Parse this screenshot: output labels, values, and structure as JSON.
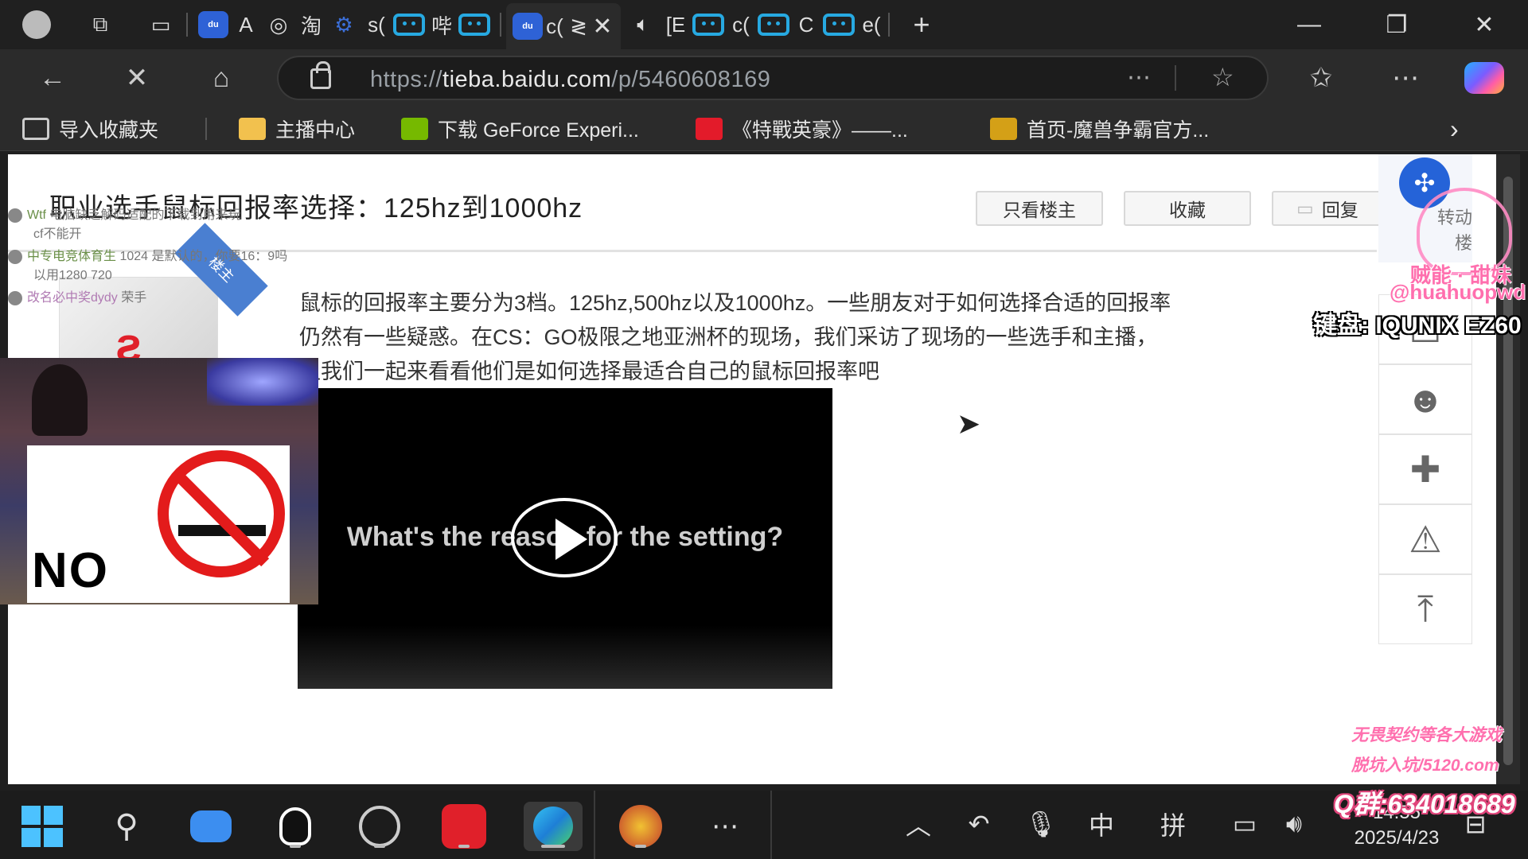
{
  "browser": {
    "tabs_text": [
      "A",
      "淘",
      "s(",
      "哔",
      "c(",
      "≷",
      "[E",
      "c(",
      "C",
      "e("
    ],
    "url_scheme": "https://",
    "url_host": "tieba.baidu.com",
    "url_path": "/p/5460608169",
    "favorites": [
      {
        "label": "导入收藏夹",
        "color": "#cccccc"
      },
      {
        "label": "主播中心",
        "color": "#f2c14e"
      },
      {
        "label": "下载 GeForce Experi...",
        "color": "#76b900"
      },
      {
        "label": "《特戰英豪》——...",
        "color": "#e31b2a"
      },
      {
        "label": "首页-魔兽争霸官方...",
        "color": "#d4a017"
      }
    ]
  },
  "post": {
    "title": "职业选手鼠标回报率选择：125hz到1000hz",
    "buttons": {
      "op_only": "只看楼主",
      "favorite": "收藏",
      "reply": "回复"
    },
    "body_lines": [
      "鼠标的回报率主要分为3档。125hz,500hz以及1000hz。一些朋友对于如何选择合适的回报率",
      "仍然有一些疑惑。在CS：GO极限之地亚洲杯的现场，我们采访了现场的一些选手和主播，",
      "让我们一起来看看他们是如何选择最适合自己的鼠标回报率吧"
    ],
    "video_caption": "What's the reason for the setting?",
    "badge": "楼主"
  },
  "chat": [
    {
      "name": "Wtf",
      "text": "电脑缺乏解码适配的下载到用来玩",
      "sub": "cf不能开"
    },
    {
      "name": "中专电竞体育生",
      "text": "1024 是默认的，你要16：9吗",
      "sub": "以用1280 720"
    },
    {
      "name": "改名必中奖dydy",
      "text": "荣手",
      "sub": ""
    }
  ],
  "webcam": {
    "sign_text": "NO"
  },
  "overlay": {
    "name": "贼能 · 甜妹",
    "handle": "@huahuopwd",
    "keyboard": "键盘: IQUNIX EZ60",
    "promo1": "无畏契约等各大游戏",
    "promo2": "脱坑入坑/5120.com",
    "qq": "Q群:634018689"
  },
  "side_tool_labels": [
    "转动",
    "楼"
  ],
  "taskbar": {
    "time": "14:55",
    "date": "2025/4/23",
    "ime_lang": "中",
    "ime_mode": "拼"
  }
}
